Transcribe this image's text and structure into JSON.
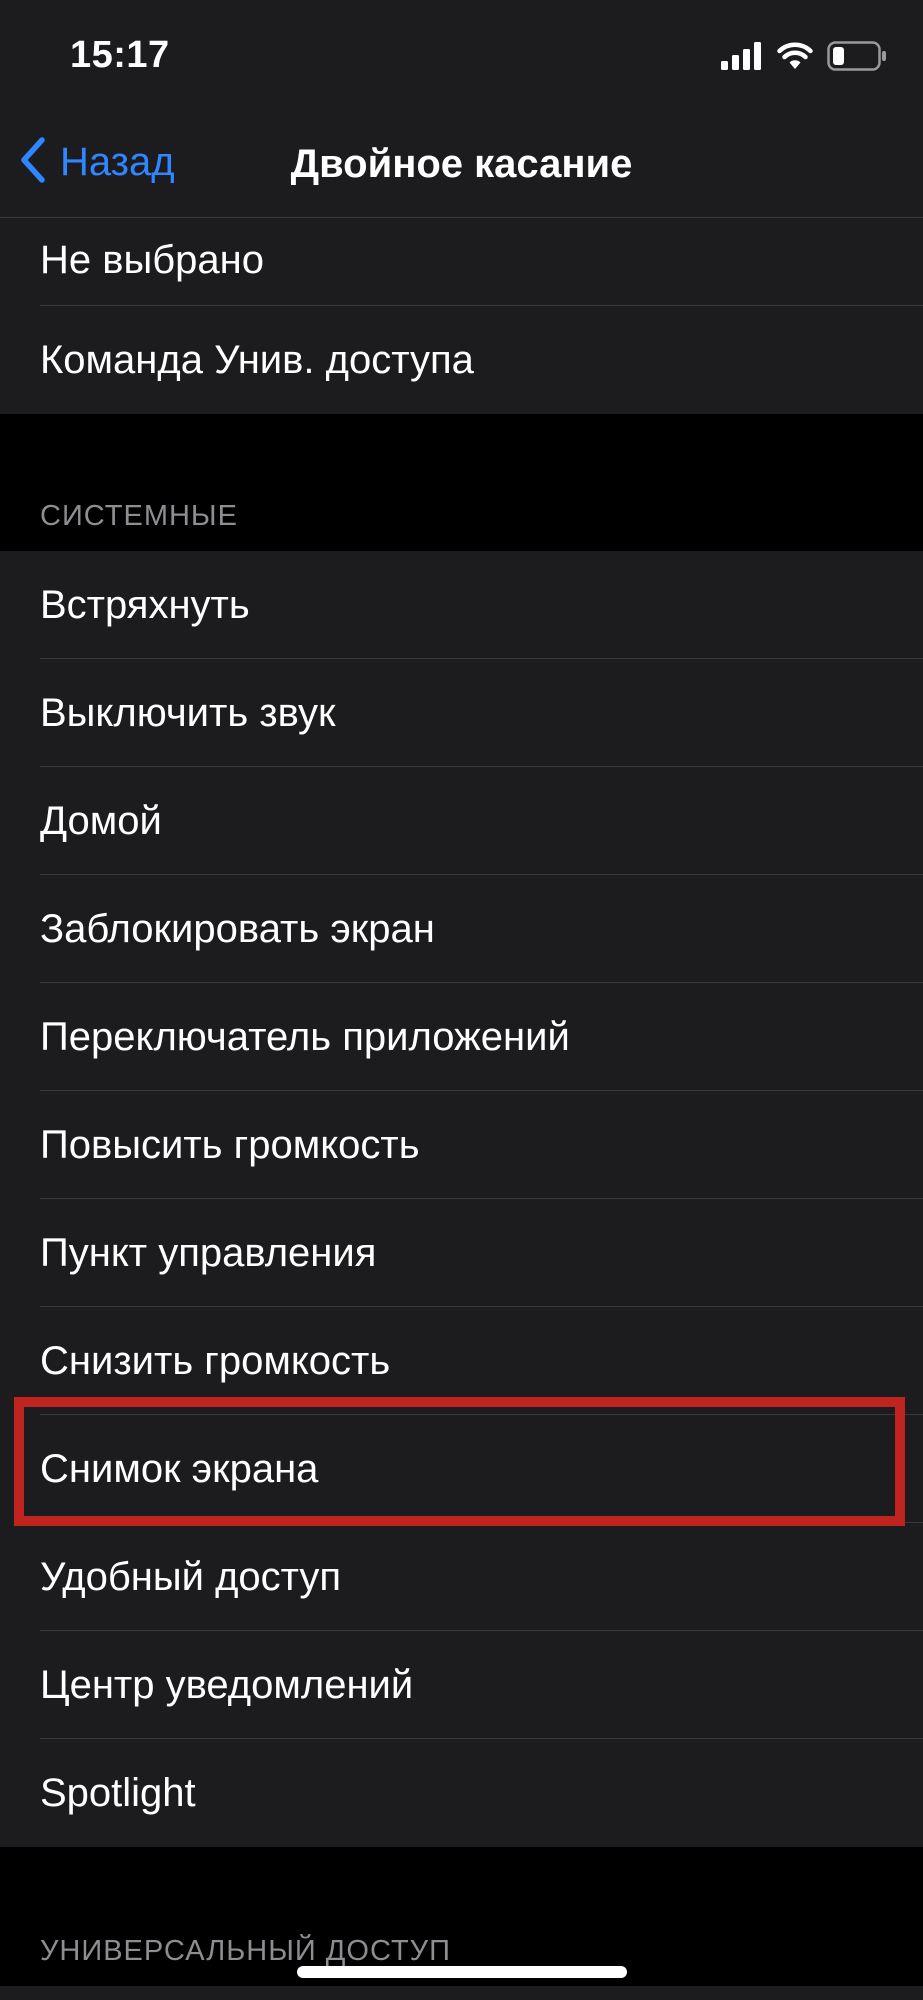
{
  "status_bar": {
    "time": "15:17",
    "icons": [
      "cellular-signal-icon",
      "wifi-icon",
      "battery-icon"
    ],
    "battery_level": 0.25
  },
  "nav": {
    "back_label": "Назад",
    "title": "Двойное касание",
    "accent_color": "#2f86ff"
  },
  "top_group": {
    "items": [
      {
        "label": "Не выбрано"
      },
      {
        "label": "Команда Унив. доступа"
      }
    ]
  },
  "system_section": {
    "header": "СИСТЕМНЫЕ",
    "items": [
      {
        "label": "Встряхнуть"
      },
      {
        "label": "Выключить звук"
      },
      {
        "label": "Домой"
      },
      {
        "label": "Заблокировать экран"
      },
      {
        "label": "Переключатель приложений"
      },
      {
        "label": "Повысить громкость"
      },
      {
        "label": "Пункт управления"
      },
      {
        "label": "Снизить громкость"
      },
      {
        "label": "Снимок экрана"
      },
      {
        "label": "Удобный доступ"
      },
      {
        "label": "Центр уведомлений"
      },
      {
        "label": "Spotlight"
      }
    ],
    "highlighted_item": "Снимок экрана",
    "highlight_color": "#c0241f"
  },
  "accessibility_section": {
    "header": "УНИВЕРСАЛЬНЫЙ ДОСТУП"
  }
}
